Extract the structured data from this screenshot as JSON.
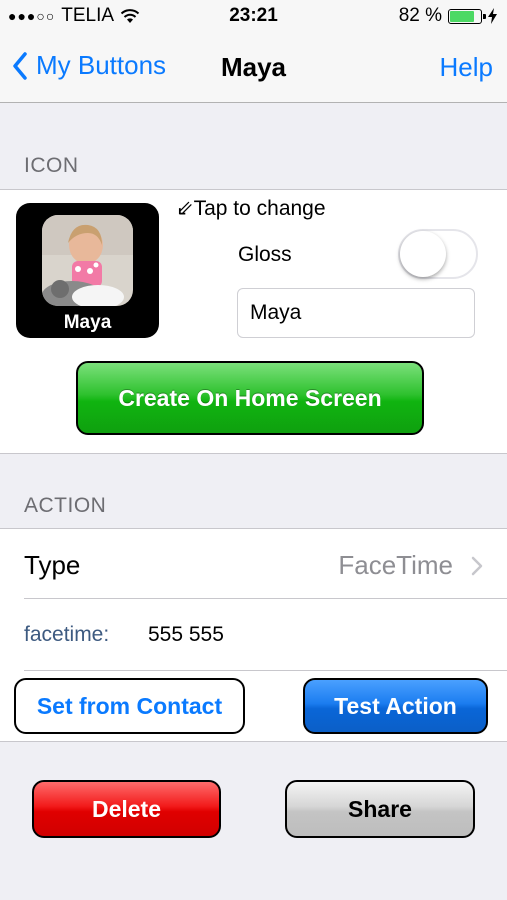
{
  "status_bar": {
    "signal": "●●●○○",
    "carrier": "TELIA",
    "time": "23:21",
    "battery_text": "82 %",
    "battery_level_percent": 82,
    "battery_color": "#4cd964"
  },
  "nav": {
    "back_label": "My Buttons",
    "title": "Maya",
    "help_label": "Help",
    "accent_color": "#0a7aff"
  },
  "icon_section": {
    "header": "ICON",
    "icon_label": "Maya",
    "tap_hint": "⇙Tap to change",
    "gloss_label": "Gloss",
    "gloss_on": false,
    "name_value": "Maya",
    "create_button": "Create On Home Screen"
  },
  "action_section": {
    "header": "ACTION",
    "type_label": "Type",
    "type_value": "FaceTime",
    "field_label": "facetime:",
    "field_value": "555 555",
    "set_contact_button": "Set from Contact",
    "test_button": "Test Action"
  },
  "footer": {
    "delete_button": "Delete",
    "share_button": "Share"
  }
}
